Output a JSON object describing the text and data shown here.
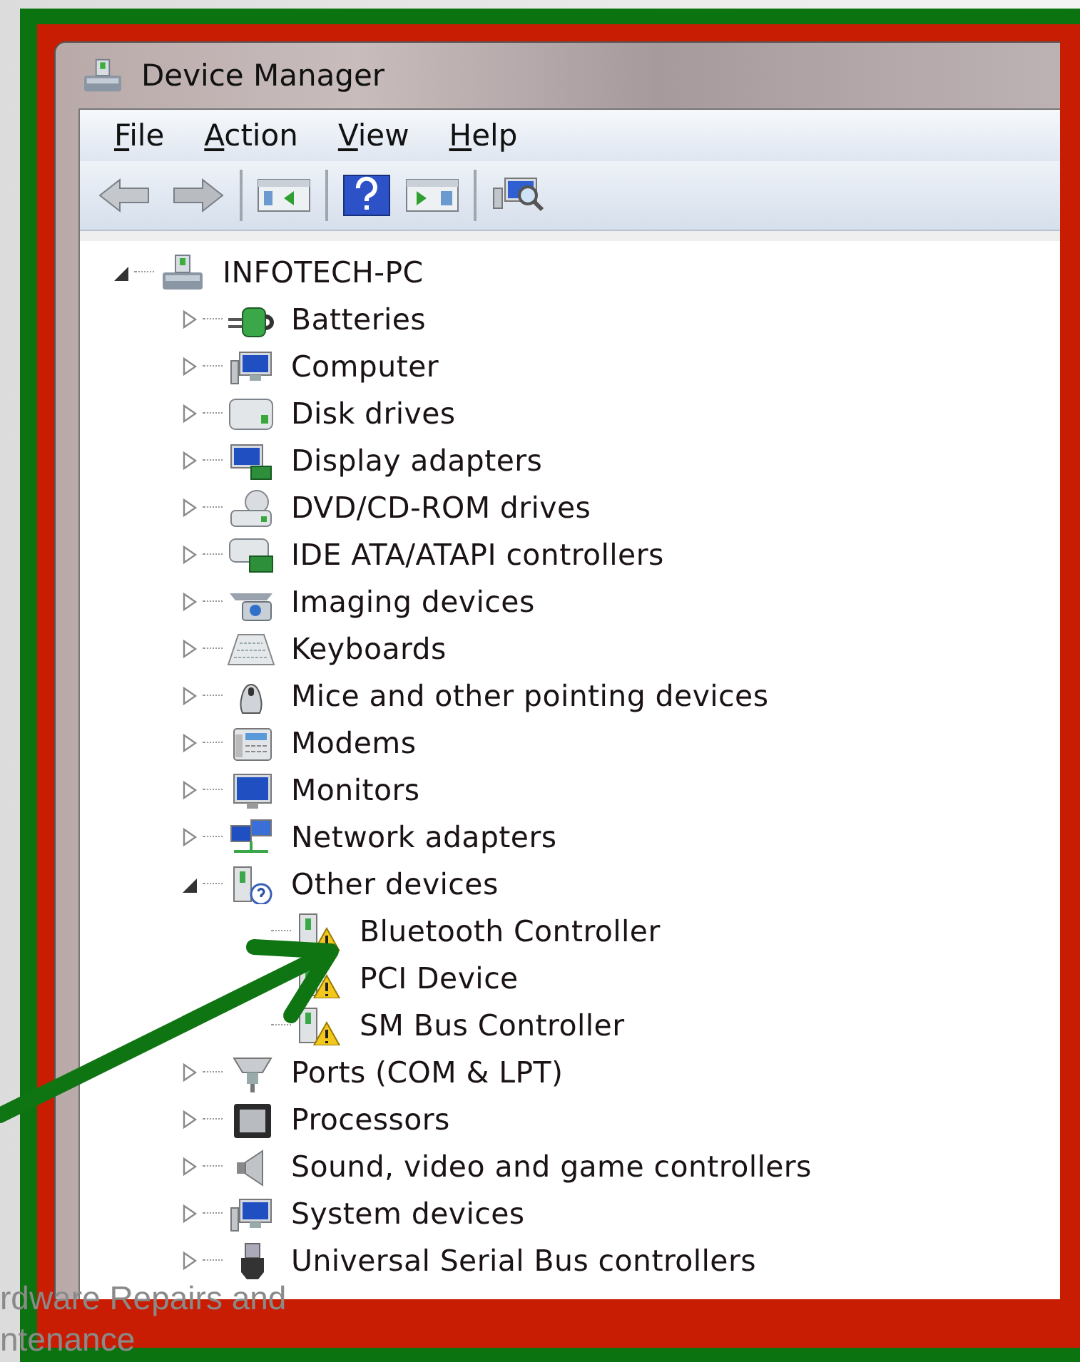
{
  "window": {
    "title": "Device Manager"
  },
  "menu": [
    "File",
    "Action",
    "View",
    "Help"
  ],
  "tree": {
    "root": {
      "label": "INFOTECH-PC",
      "kind": "computer",
      "expanded": true,
      "children": [
        {
          "label": "Batteries",
          "kind": "battery",
          "expanded": false
        },
        {
          "label": "Computer",
          "kind": "pc",
          "expanded": false
        },
        {
          "label": "Disk drives",
          "kind": "disk",
          "expanded": false
        },
        {
          "label": "Display adapters",
          "kind": "display",
          "expanded": false
        },
        {
          "label": "DVD/CD-ROM drives",
          "kind": "dvd",
          "expanded": false
        },
        {
          "label": "IDE ATA/ATAPI controllers",
          "kind": "ide",
          "expanded": false
        },
        {
          "label": "Imaging devices",
          "kind": "camera",
          "expanded": false
        },
        {
          "label": "Keyboards",
          "kind": "keyboard",
          "expanded": false
        },
        {
          "label": "Mice and other pointing devices",
          "kind": "mouse",
          "expanded": false
        },
        {
          "label": "Modems",
          "kind": "modem",
          "expanded": false
        },
        {
          "label": "Monitors",
          "kind": "monitor",
          "expanded": false
        },
        {
          "label": "Network adapters",
          "kind": "network",
          "expanded": false
        },
        {
          "label": "Other devices",
          "kind": "unknown",
          "expanded": true,
          "children": [
            {
              "label": "Bluetooth Controller",
              "kind": "warning"
            },
            {
              "label": "PCI Device",
              "kind": "warning"
            },
            {
              "label": "SM Bus Controller",
              "kind": "warning"
            }
          ]
        },
        {
          "label": "Ports (COM & LPT)",
          "kind": "port",
          "expanded": false
        },
        {
          "label": "Processors",
          "kind": "cpu",
          "expanded": false
        },
        {
          "label": "Sound, video and game controllers",
          "kind": "sound",
          "expanded": false
        },
        {
          "label": "System devices",
          "kind": "pc",
          "expanded": false
        },
        {
          "label": "Universal Serial Bus controllers",
          "kind": "usb",
          "expanded": false
        }
      ]
    }
  },
  "footer": [
    "rdware Repairs and",
    "ntenance"
  ]
}
